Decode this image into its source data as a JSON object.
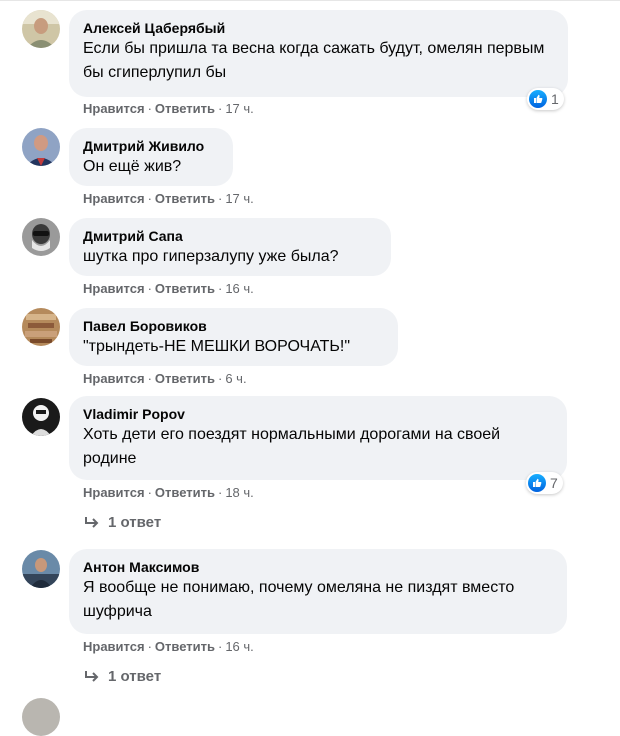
{
  "labels": {
    "like": "Нравится",
    "reply": "Ответить"
  },
  "colors": {
    "bubble": "#f0f2f5",
    "meta": "#65676b",
    "like_blue": "#1877f2"
  },
  "comments": [
    {
      "author": "Алексей Цаберябый",
      "text": "Если бы пришла та весна когда сажать будут, омелян первым бы сгиперлупил бы",
      "time": "17 ч.",
      "reactions": "1",
      "avatar_icon": "user-avatar-photo"
    },
    {
      "author": "Дмитрий Живило",
      "text": "Он ещё жив?",
      "time": "17 ч.",
      "avatar_icon": "user-avatar-photo"
    },
    {
      "author": "Дмитрий Сапа",
      "text": "шутка про гиперзалупу уже была?",
      "time": "16 ч.",
      "avatar_icon": "user-avatar-photo"
    },
    {
      "author": "Павел Боровиков",
      "text": "\"трындеть-НЕ МЕШКИ ВОРОЧАТЬ!\"",
      "time": "6 ч.",
      "avatar_icon": "user-avatar-photo"
    },
    {
      "author": "Vladimir Popov",
      "text": "Хоть дети его поездят нормальными дорогами на своей родине",
      "time": "18 ч.",
      "reactions": "7",
      "replies": "1 ответ",
      "avatar_icon": "user-avatar-photo"
    },
    {
      "author": "Антон Максимов",
      "text": "Я вообще не понимаю, почему омеляна не пиздят вместо шуфрича",
      "time": "16 ч.",
      "replies": "1 ответ",
      "avatar_icon": "user-avatar-photo"
    }
  ]
}
